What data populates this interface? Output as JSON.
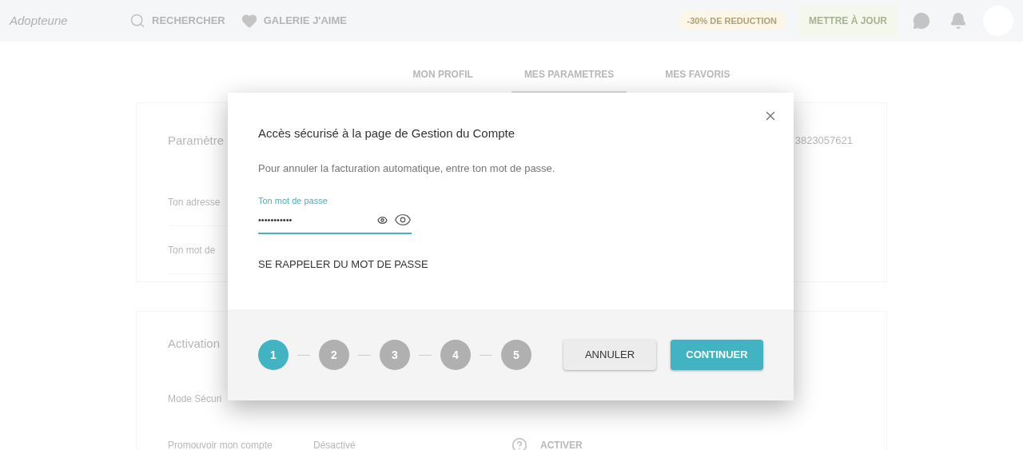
{
  "header": {
    "logo": "Adopteune",
    "nav": [
      {
        "label": "RECHERCHER",
        "kind": "search"
      },
      {
        "label": "GALERIE J'AIME",
        "kind": "heart"
      }
    ],
    "promo": "-30% DE REDUCTION",
    "upgrade": "METTRE À JOUR"
  },
  "tabs": [
    {
      "label": "MON PROFIL",
      "selected": false
    },
    {
      "label": "MES PARAMETRES",
      "selected": true
    },
    {
      "label": "MES FAVORIS",
      "selected": false
    }
  ],
  "settings_card": {
    "title": "Paramètre",
    "value": "3823057621",
    "rows": [
      {
        "label": "Ton adresse"
      },
      {
        "label": "Ton mot de"
      }
    ]
  },
  "activation_card": {
    "title": "Activation",
    "rows": [
      {
        "label": "Mode Sécuri"
      },
      {
        "label": "Promouvoir mon compte",
        "status": "Désactivé",
        "action": "ACTIVER"
      }
    ]
  },
  "dialog": {
    "title": "Accès sécurisé à la page de Gestion du Compte",
    "text": "Pour annuler la facturation automatique, entre ton mot de passe.",
    "password": {
      "label": "Ton mot de passe",
      "value": "•••••••••••"
    },
    "link": "SE RAPPELER DU MOT DE PASSE",
    "steps": [
      {
        "label": "1",
        "selected": true
      },
      {
        "label": "2",
        "selected": false
      },
      {
        "label": "3",
        "selected": false
      },
      {
        "label": "4",
        "selected": false
      },
      {
        "label": "5",
        "selected": false
      }
    ],
    "buttons": [
      {
        "label": "ANNULER",
        "kind": "secondary"
      },
      {
        "label": "CONTINUER",
        "kind": "primary"
      }
    ]
  }
}
